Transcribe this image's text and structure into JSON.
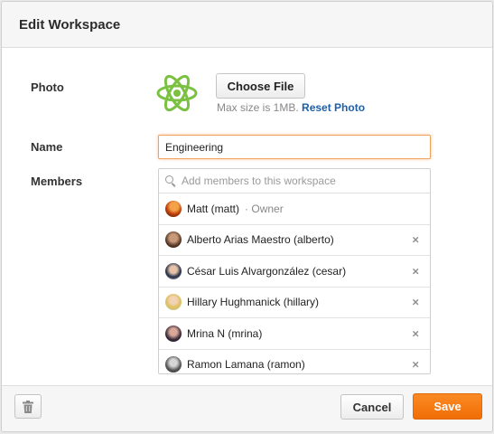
{
  "dialog": {
    "title": "Edit Workspace"
  },
  "photo": {
    "label": "Photo",
    "choose_label": "Choose File",
    "max_size_text": "Max size is 1MB.",
    "reset_label": "Reset Photo",
    "logo_icon": "atom-icon",
    "logo_color": "#7ac142"
  },
  "name": {
    "label": "Name",
    "value": "Engineering"
  },
  "members": {
    "label": "Members",
    "search_placeholder": "Add members to this workspace",
    "owner_label": "Owner",
    "owner_separator": "·",
    "remove_glyph": "×",
    "list": [
      {
        "name": "Matt (matt)",
        "owner": true
      },
      {
        "name": "Alberto Arias Maestro (alberto)",
        "owner": false
      },
      {
        "name": "César Luis Alvargonzález (cesar)",
        "owner": false
      },
      {
        "name": "Hillary Hughmanick (hillary)",
        "owner": false
      },
      {
        "name": "Mrina N (mrina)",
        "owner": false
      },
      {
        "name": "Ramon Lamana (ramon)",
        "owner": false
      }
    ]
  },
  "footer": {
    "delete_icon": "trash-icon",
    "cancel_label": "Cancel",
    "save_label": "Save",
    "accent_color": "#f47b14"
  }
}
